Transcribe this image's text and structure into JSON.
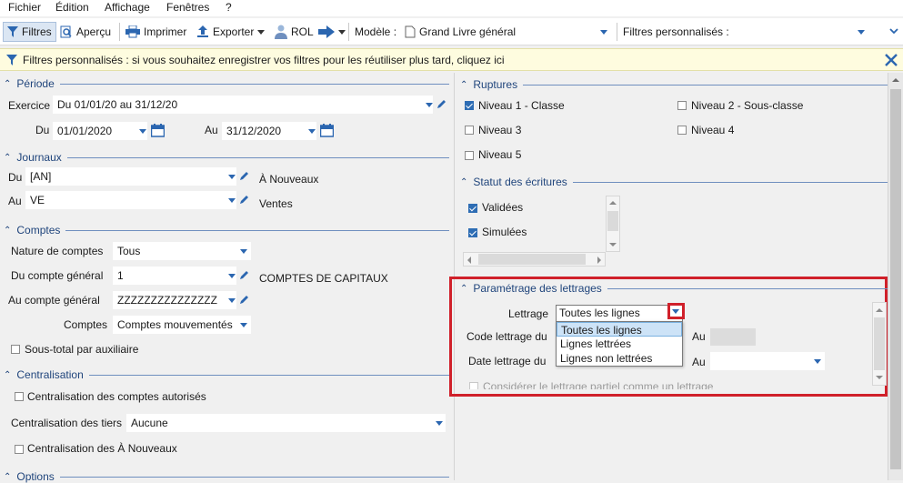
{
  "menu": [
    "Fichier",
    "Édition",
    "Affichage",
    "Fenêtres",
    "?"
  ],
  "toolbar": {
    "filtres": "Filtres",
    "apercu": "Aperçu",
    "imprimer": "Imprimer",
    "exporter": "Exporter",
    "rol": "ROL",
    "modele_label": "Modèle :",
    "modele_value": "Grand Livre général",
    "filtres_perso_label": "Filtres personnalisés :"
  },
  "info_bar": {
    "text": "Filtres personnalisés : si vous souhaitez enregistrer vos filtres pour les réutiliser plus tard, cliquez ici"
  },
  "periode": {
    "title": "Période",
    "exercice_label": "Exercice",
    "exercice_value": "Du 01/01/20 au 31/12/20",
    "du_label": "Du",
    "du_value": "01/01/2020",
    "au_label": "Au",
    "au_value": "31/12/2020"
  },
  "journaux": {
    "title": "Journaux",
    "du_label": "Du",
    "du_value": "[AN]",
    "du_desc": "À Nouveaux",
    "au_label": "Au",
    "au_value": "VE",
    "au_desc": "Ventes"
  },
  "comptes": {
    "title": "Comptes",
    "nature_label": "Nature de comptes",
    "nature_value": "Tous",
    "du_label": "Du compte général",
    "du_value": "1",
    "du_desc": "COMPTES DE CAPITAUX",
    "au_label": "Au compte général",
    "au_value": "ZZZZZZZZZZZZZZZ",
    "comptes_label": "Comptes",
    "comptes_value": "Comptes mouvementés",
    "sous_total": "Sous-total par auxiliaire"
  },
  "centralisation": {
    "title": "Centralisation",
    "comptes_autorises": "Centralisation des comptes autorisés",
    "tiers_label": "Centralisation des tiers",
    "tiers_value": "Aucune",
    "a_nouveaux": "Centralisation des À Nouveaux"
  },
  "options": {
    "title": "Options"
  },
  "ruptures": {
    "title": "Ruptures",
    "niveau1": "Niveau 1 - Classe",
    "niveau2": "Niveau 2 - Sous-classe",
    "niveau3": "Niveau 3",
    "niveau4": "Niveau 4",
    "niveau5": "Niveau 5"
  },
  "statut": {
    "title": "Statut des écritures",
    "validees": "Validées",
    "simulees": "Simulées"
  },
  "lettrage": {
    "title": "Paramétrage des lettrages",
    "lettrage_label": "Lettrage",
    "lettrage_value": "Toutes les lignes",
    "options": [
      "Toutes les lignes",
      "Lignes lettrées",
      "Lignes non lettrées"
    ],
    "code_label": "Code lettrage du",
    "date_label": "Date lettrage du",
    "au_label": "Au",
    "au2_label": "Au",
    "partiel": "Considérer le lettrage partiel comme un lettrage"
  },
  "colors": {
    "accent": "#2b66b0",
    "highlight_box": "#d0202a",
    "info_bg": "#fefcdf"
  }
}
